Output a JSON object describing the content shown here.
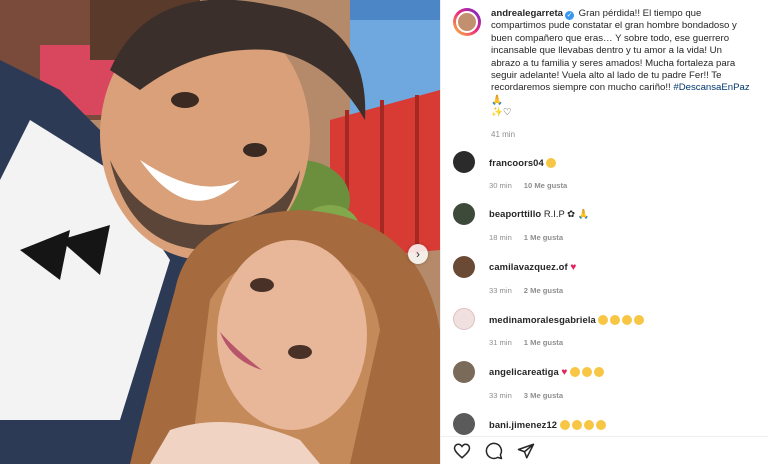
{
  "post": {
    "username": "andrealegarreta",
    "caption_body": "Gran pérdida!! El tiempo que compartimos pude constatar el gran hombre bondadoso y buen compañero que eras… Y sobre todo, ese guerrero incansable que llevabas dentro y tu amor a la vida! Un abrazo a tu familia y seres amados! Mucha fortaleza para seguir adelante! Vuela alto al lado de tu padre Fer!! Te recordaremos siempre con mucho cariño!!",
    "hashtag": "#DescansaEnPaz",
    "time": "41 min",
    "verified_icon": "verified-badge-icon",
    "pray_icon": "folded-hands-icon",
    "sparkle_heart_icons": "sparkles-and-white-heart-icons"
  },
  "comments": [
    {
      "username": "francoors04",
      "text": "",
      "emoji_icon": "crying-face-icon",
      "time": "30 min",
      "likes": "10 Me gusta"
    },
    {
      "username": "beaporttillo",
      "text": "R.I.P",
      "emoji_icon": "flower-and-folded-hands-icons",
      "time": "18 min",
      "likes": "1 Me gusta"
    },
    {
      "username": "camilavazquez.of",
      "text": "",
      "emoji_icon": "red-heart-icon",
      "time": "33 min",
      "likes": "2 Me gusta"
    },
    {
      "username": "medinamoralesgabriela",
      "text": "",
      "emoji_icon": "sad-faces-icon",
      "time": "31 min",
      "likes": "1 Me gusta"
    },
    {
      "username": "angelicareatiga",
      "text": "",
      "emoji_icon": "heart-and-sad-faces-icon",
      "time": "33 min",
      "likes": "3 Me gusta"
    },
    {
      "username": "bani.jimenez12",
      "text": "",
      "emoji_icon": "sad-faces-icon",
      "time": "",
      "likes": ""
    }
  ],
  "actions": {
    "like_icon": "heart-outline-icon",
    "comment_icon": "comment-bubble-icon",
    "share_icon": "paper-plane-icon"
  },
  "colors": {
    "link": "#00376b",
    "verified": "#3897f0",
    "meta_gray": "#8e8e8e",
    "heart_red": "#e0245e"
  }
}
